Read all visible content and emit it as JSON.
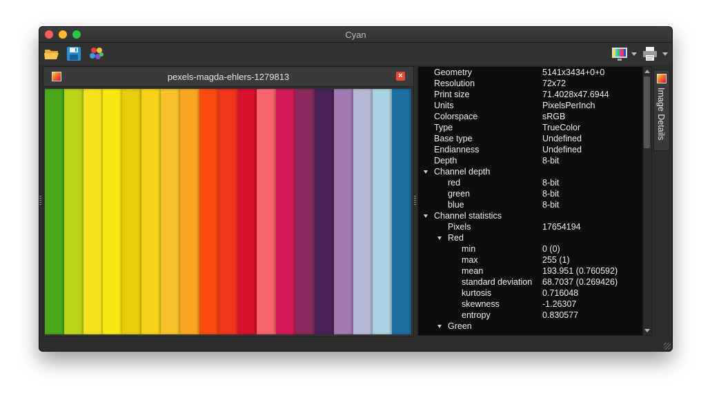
{
  "window": {
    "title": "Cyan"
  },
  "toolbar": {
    "open_icon": "folder-open-icon",
    "save_icon": "save-icon",
    "colors_icon": "color-palette-icon",
    "display_icon": "monitor-icon",
    "print_icon": "printer-icon"
  },
  "image_tab": {
    "title": "pexels-magda-ehlers-1279813"
  },
  "image": {
    "stripe_colors": [
      "#4aa81a",
      "#bcd41a",
      "#f5e21c",
      "#f6e80f",
      "#e9cd0a",
      "#f5d21a",
      "#f7c22a",
      "#f9a51f",
      "#fb4b10",
      "#f0351c",
      "#d8102c",
      "#f7646b",
      "#d21a56",
      "#8a2a5c",
      "#4a2356",
      "#a07ab0",
      "#b5b9d6",
      "#a9d3e0",
      "#1c6fa2"
    ]
  },
  "details": {
    "side_tab_label": "Image Details",
    "rows": [
      {
        "key": "Geometry",
        "value": "5141x3434+0+0",
        "level": 0,
        "expander": false
      },
      {
        "key": "Resolution",
        "value": "72x72",
        "level": 0,
        "expander": false
      },
      {
        "key": "Print size",
        "value": "71.4028x47.6944",
        "level": 0,
        "expander": false
      },
      {
        "key": "Units",
        "value": "PixelsPerInch",
        "level": 0,
        "expander": false
      },
      {
        "key": "Colorspace",
        "value": "sRGB",
        "level": 0,
        "expander": false
      },
      {
        "key": "Type",
        "value": "TrueColor",
        "level": 0,
        "expander": false
      },
      {
        "key": "Base type",
        "value": "Undefined",
        "level": 0,
        "expander": false
      },
      {
        "key": "Endianness",
        "value": "Undefined",
        "level": 0,
        "expander": false
      },
      {
        "key": "Depth",
        "value": "8-bit",
        "level": 0,
        "expander": false
      },
      {
        "key": "Channel depth",
        "value": "",
        "level": 0,
        "expander": true
      },
      {
        "key": "red",
        "value": "8-bit",
        "level": 1,
        "expander": false
      },
      {
        "key": "green",
        "value": "8-bit",
        "level": 1,
        "expander": false
      },
      {
        "key": "blue",
        "value": "8-bit",
        "level": 1,
        "expander": false
      },
      {
        "key": "Channel statistics",
        "value": "",
        "level": 0,
        "expander": true
      },
      {
        "key": "Pixels",
        "value": "17654194",
        "level": 1,
        "expander": false
      },
      {
        "key": "Red",
        "value": "",
        "level": 1,
        "expander": true
      },
      {
        "key": "min",
        "value": "0  (0)",
        "level": 2,
        "expander": false
      },
      {
        "key": "max",
        "value": "255 (1)",
        "level": 2,
        "expander": false
      },
      {
        "key": "mean",
        "value": "193.951 (0.760592)",
        "level": 2,
        "expander": false
      },
      {
        "key": "standard deviation",
        "value": "68.7037 (0.269426)",
        "level": 2,
        "expander": false
      },
      {
        "key": "kurtosis",
        "value": "0.716048",
        "level": 2,
        "expander": false
      },
      {
        "key": "skewness",
        "value": "-1.26307",
        "level": 2,
        "expander": false
      },
      {
        "key": "entropy",
        "value": "0.830577",
        "level": 2,
        "expander": false
      },
      {
        "key": "Green",
        "value": "",
        "level": 1,
        "expander": true
      }
    ]
  }
}
